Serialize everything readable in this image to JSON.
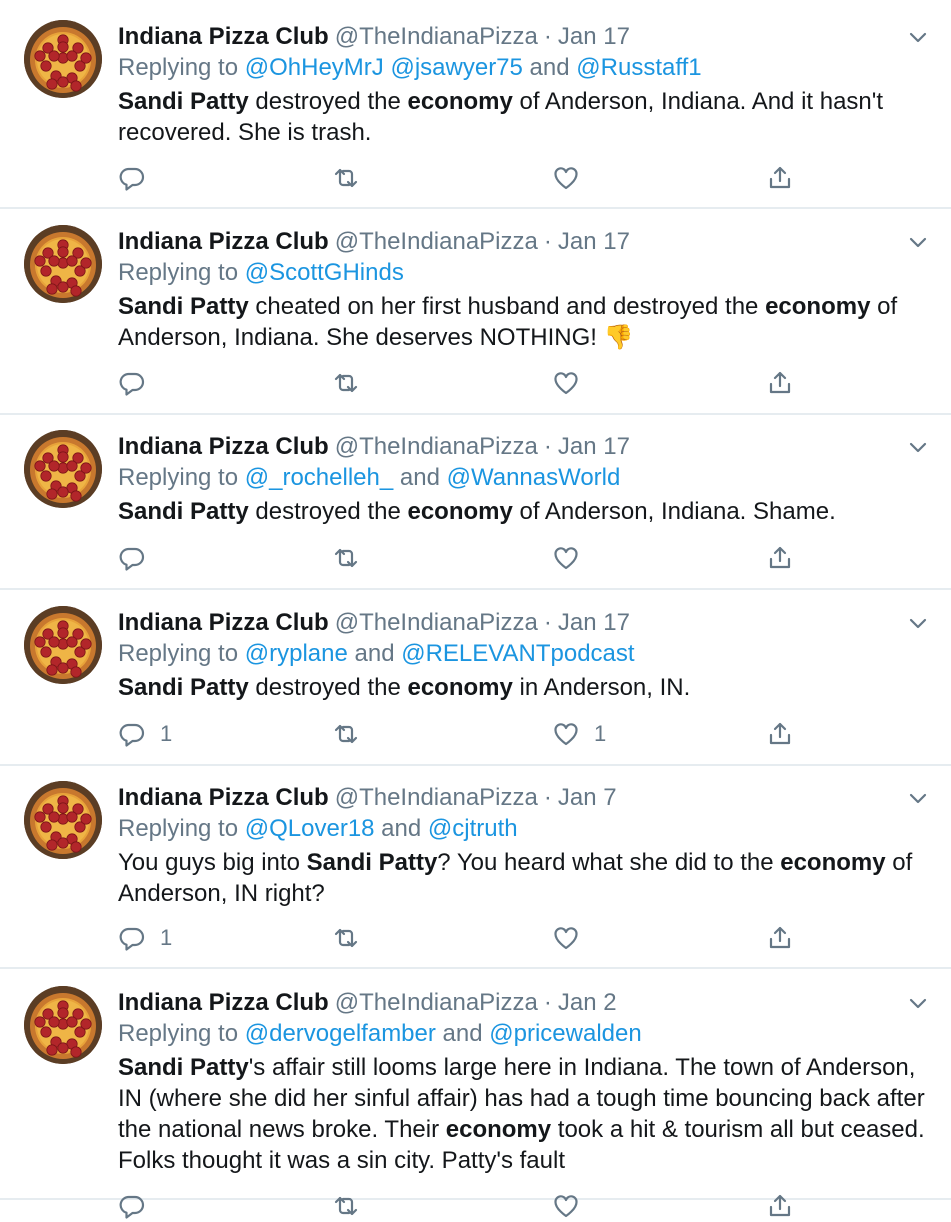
{
  "colors": {
    "link": "#1b95e0",
    "muted": "#657786",
    "text": "#14171a",
    "divider": "#e6ecf0"
  },
  "icons": {
    "reply": "reply-icon",
    "retweet": "retweet-icon",
    "like": "heart-icon",
    "share": "share-icon",
    "more": "chevron-down-icon",
    "avatar": "pizza-avatar"
  },
  "account": {
    "name": "Indiana Pizza Club",
    "handle": "@TheIndianaPizza",
    "separator": "·"
  },
  "tweets": [
    {
      "date": "Jan 17",
      "replying_prefix": "Replying to ",
      "mentions": [
        "@OhHeyMrJ",
        "@jsawyer75",
        "@Russtaff1"
      ],
      "joiners": [
        " ",
        " and "
      ],
      "body": [
        {
          "t": "Sandi Patty",
          "b": true
        },
        {
          "t": " destroyed the ",
          "b": false
        },
        {
          "t": "economy",
          "b": true
        },
        {
          "t": " of Anderson, Indiana. And it hasn't recovered. She is trash.",
          "b": false
        }
      ],
      "reply_count": "",
      "like_count": ""
    },
    {
      "date": "Jan 17",
      "replying_prefix": "Replying to ",
      "mentions": [
        "@ScottGHinds"
      ],
      "joiners": [],
      "body": [
        {
          "t": "Sandi Patty",
          "b": true
        },
        {
          "t": " cheated on her first husband and destroyed the ",
          "b": false
        },
        {
          "t": "economy",
          "b": true
        },
        {
          "t": " of Anderson, Indiana. She deserves NOTHING! 👎",
          "b": false
        }
      ],
      "reply_count": "",
      "like_count": ""
    },
    {
      "date": "Jan 17",
      "replying_prefix": "Replying to ",
      "mentions": [
        "@_rochelleh_",
        "@WannasWorld"
      ],
      "joiners": [
        " and "
      ],
      "body": [
        {
          "t": "Sandi Patty",
          "b": true
        },
        {
          "t": " destroyed the ",
          "b": false
        },
        {
          "t": "economy",
          "b": true
        },
        {
          "t": " of Anderson, Indiana. Shame.",
          "b": false
        }
      ],
      "reply_count": "",
      "like_count": ""
    },
    {
      "date": "Jan 17",
      "replying_prefix": "Replying to ",
      "mentions": [
        "@ryplane",
        "@RELEVANTpodcast"
      ],
      "joiners": [
        " and "
      ],
      "body": [
        {
          "t": "Sandi Patty",
          "b": true
        },
        {
          "t": " destroyed the ",
          "b": false
        },
        {
          "t": "economy",
          "b": true
        },
        {
          "t": " in Anderson, IN.",
          "b": false
        }
      ],
      "reply_count": "1",
      "like_count": "1"
    },
    {
      "date": "Jan 7",
      "replying_prefix": "Replying to ",
      "mentions": [
        "@QLover18",
        "@cjtruth"
      ],
      "joiners": [
        " and "
      ],
      "body": [
        {
          "t": "You guys big into ",
          "b": false
        },
        {
          "t": "Sandi Patty",
          "b": true
        },
        {
          "t": "? You heard what she did to the ",
          "b": false
        },
        {
          "t": "economy",
          "b": true
        },
        {
          "t": " of Anderson, IN right?",
          "b": false
        }
      ],
      "reply_count": "1",
      "like_count": ""
    },
    {
      "date": "Jan 2",
      "replying_prefix": "Replying to ",
      "mentions": [
        "@dervogelfamber",
        "@pricewalden"
      ],
      "joiners": [
        " and "
      ],
      "body": [
        {
          "t": "Sandi Patty",
          "b": true
        },
        {
          "t": "'s affair still looms large here in Indiana. The town of Anderson, IN (where she did her sinful affair) has had a tough time bouncing back after the national news broke. Their ",
          "b": false
        },
        {
          "t": "economy",
          "b": true
        },
        {
          "t": " took a hit & tourism all but ceased. Folks thought it was a sin city. Patty's fault",
          "b": false
        }
      ],
      "reply_count": "",
      "like_count": ""
    }
  ]
}
